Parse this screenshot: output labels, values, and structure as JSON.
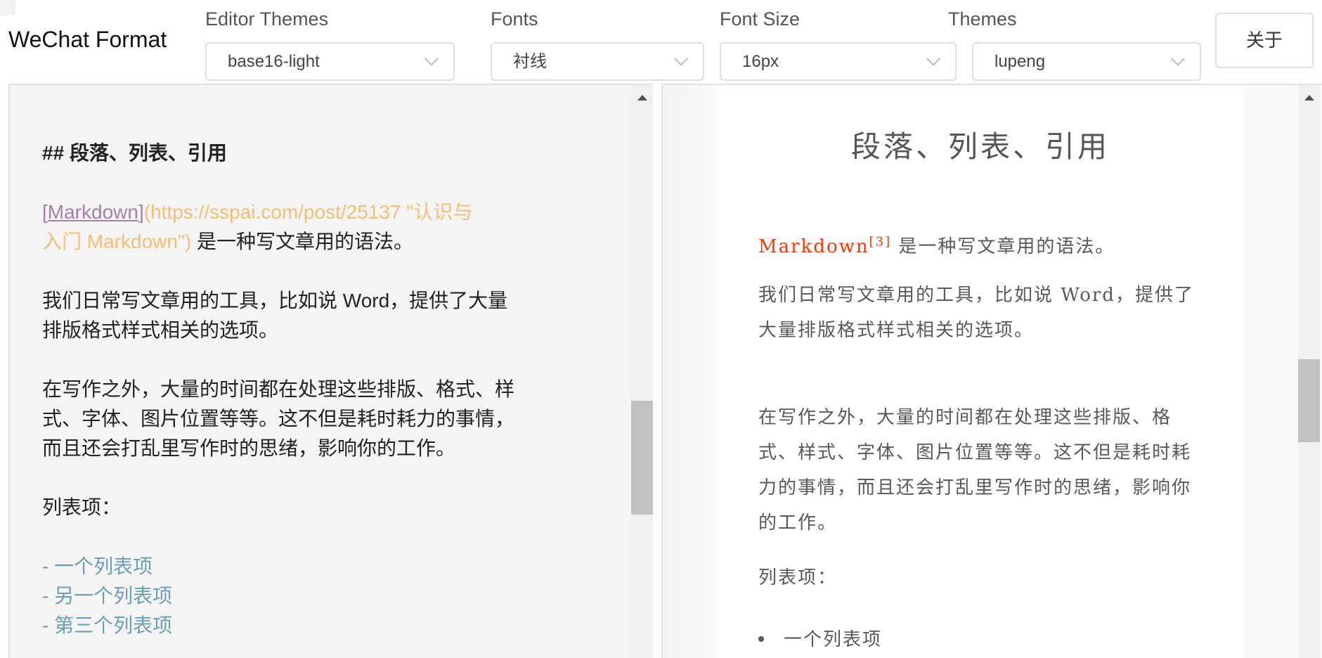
{
  "header": {
    "title": "WeChat Format",
    "about": "关于",
    "controls": [
      {
        "label": "Editor Themes",
        "value": "base16-light"
      },
      {
        "label": "Fonts",
        "value": "衬线"
      },
      {
        "label": "Font Size",
        "value": "16px"
      },
      {
        "label": "Themes",
        "value": "lupeng"
      }
    ]
  },
  "editor": {
    "heading": "## 段落、列表、引用",
    "link_open": "[",
    "link_text": "Markdown",
    "link_close": "]",
    "link_url_1": "(https://sspai.com/post/25137 \"认识与",
    "link_url_2": "入门 Markdown\")",
    "link_tail": " 是一种写文章用的语法。",
    "p1": [
      "我们日常写文章用的工具，比如说 Word，提供了大量",
      "排版格式样式相关的选项。"
    ],
    "p2": [
      "在写作之外，大量的时间都在处理这些排版、格式、样",
      "式、字体、图片位置等等。这不但是耗时耗力的事情，",
      "而且还会打乱里写作时的思绪，影响你的工作。"
    ],
    "list_label": "列表项：",
    "items": [
      "- 一个列表项",
      "- 另一个列表项",
      "- 第三个列表项"
    ]
  },
  "preview": {
    "title": "段落、列表、引用",
    "link": "Markdown",
    "footnote": "[3]",
    "tail": " 是一种写文章用的语法。",
    "p1": "我们日常写文章用的工具，比如说 Word，提供了大量排版格式样式相关的选项。",
    "p2": "在写作之外，大量的时间都在处理这些排版、格式、样式、字体、图片位置等等。这不但是耗时耗力的事情，而且还会打乱里写作时的思绪，影响你的工作。",
    "list_label": "列表项：",
    "items": [
      "一个列表项"
    ]
  },
  "scroll": {
    "editor_position": 0.37,
    "preview_position": 0.48
  }
}
